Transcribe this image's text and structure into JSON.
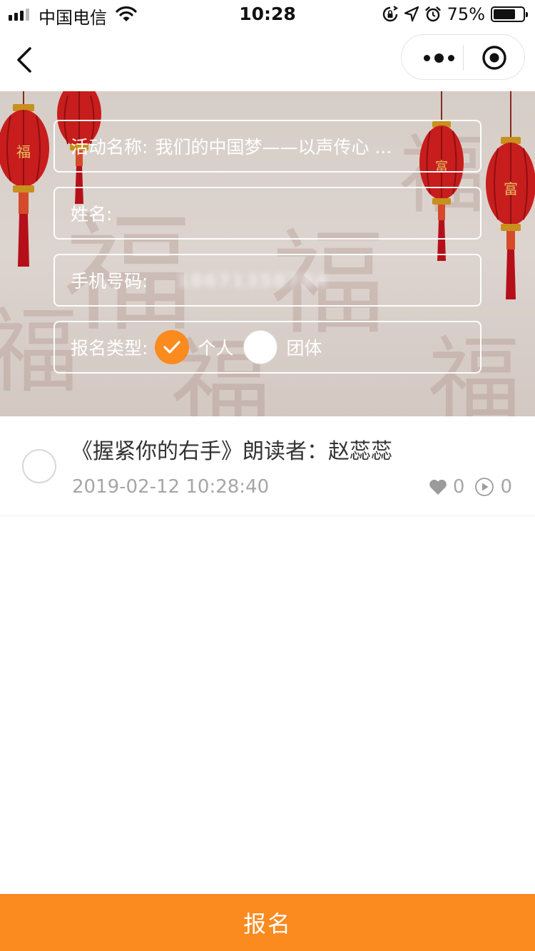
{
  "status_bar": {
    "carrier": "中国电信",
    "time": "10:28",
    "battery_percent": "75%",
    "battery_level": 0.75,
    "icons": [
      "signal-icon",
      "wifi-icon",
      "rotation-lock-icon",
      "location-icon",
      "alarm-icon",
      "battery-icon"
    ]
  },
  "nav": {
    "back_icon": "chevron-left-icon",
    "capsule_icons": [
      "more-icon",
      "close-target-icon"
    ]
  },
  "form": {
    "activity_label": "活动名称:",
    "activity_value": "我们的中国梦——以声传心 ...",
    "name_label": "姓名:",
    "name_value": "",
    "phone_label": "手机号码:",
    "phone_value": "18671358784",
    "type_label": "报名类型:",
    "type_options": [
      {
        "label": "个人",
        "selected": true
      },
      {
        "label": "团体",
        "selected": false
      }
    ],
    "accent_color": "#fb8a1f"
  },
  "list": {
    "items": [
      {
        "title": "《握紧你的右手》朗读者：赵蕊蕊",
        "time": "2019-02-12 10:28:40",
        "likes": "0",
        "plays": "0"
      }
    ]
  },
  "submit": {
    "label": "报名",
    "color": "#fb8a1f"
  }
}
